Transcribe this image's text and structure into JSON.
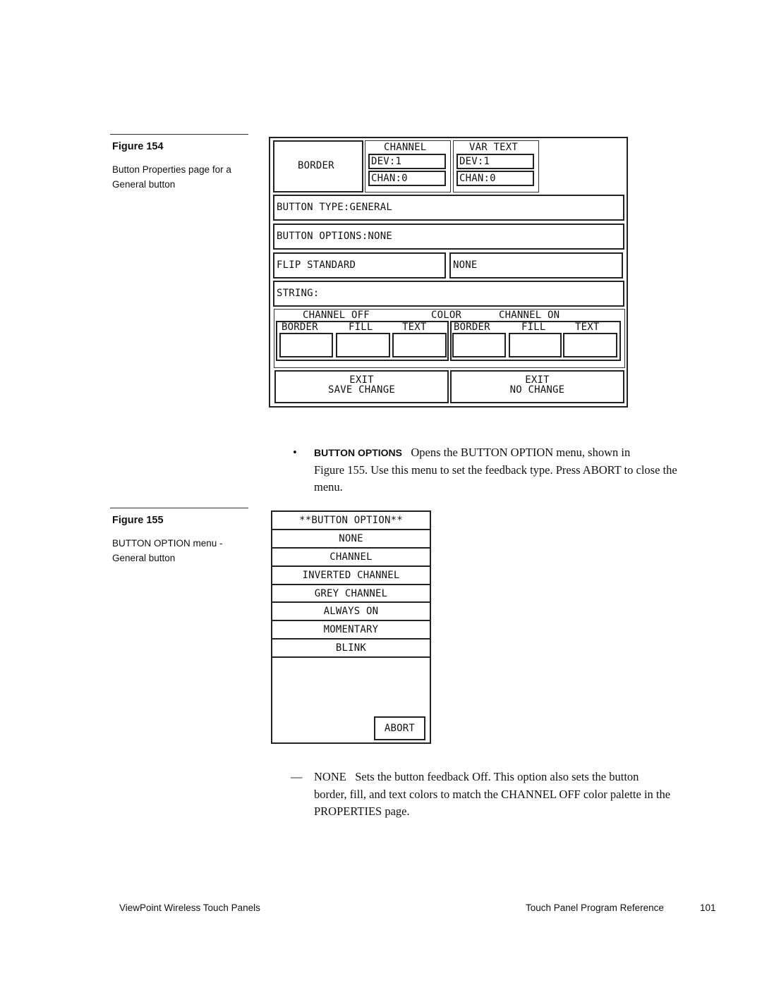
{
  "figure154": {
    "label": "Figure 154",
    "caption_line1": "Button Properties page for a",
    "caption_line2": "General button",
    "panel": {
      "border_button": "BORDER",
      "channel_group": {
        "title": "CHANNEL",
        "dev": "DEV:1",
        "chan": "CHAN:0"
      },
      "vartext_group": {
        "title": "VAR TEXT",
        "dev": "DEV:1",
        "chan": "CHAN:0"
      },
      "button_type": "BUTTON TYPE:GENERAL",
      "button_options": "BUTTON OPTIONS:NONE",
      "flip": "FLIP STANDARD",
      "flip_value": "NONE",
      "string": "STRING:",
      "color": {
        "channel_off": "CHANNEL OFF",
        "color": "COLOR",
        "channel_on": "CHANNEL ON",
        "off_labels": [
          "BORDER",
          "FILL",
          "TEXT"
        ],
        "on_labels": [
          "BORDER",
          "FILL",
          "TEXT"
        ]
      },
      "exit_save": {
        "line1": "EXIT",
        "line2": "SAVE CHANGE"
      },
      "exit_nochange": {
        "line1": "EXIT",
        "line2": "NO CHANGE"
      }
    }
  },
  "bullet": {
    "symbol": "•",
    "keyword": "BUTTON OPTIONS",
    "line1": "Opens the BUTTON OPTION menu, shown in",
    "line2": "Figure 155. Use this menu to set the feedback type. Press ABORT to close the",
    "line3": "menu."
  },
  "figure155": {
    "label": "Figure 155",
    "caption_line1": "BUTTON OPTION menu -",
    "caption_line2": "General button",
    "menu": {
      "title": "**BUTTON OPTION**",
      "items": [
        "NONE",
        "CHANNEL",
        "INVERTED CHANNEL",
        "GREY CHANNEL",
        "ALWAYS ON",
        "MOMENTARY",
        "BLINK"
      ],
      "abort": "ABORT"
    }
  },
  "dash_item": {
    "symbol": "—",
    "keyword": "NONE",
    "line1": "Sets the button feedback Off. This option also sets the button",
    "line2": "border, fill, and text colors to match the CHANNEL OFF color palette in the",
    "line3": "PROPERTIES page."
  },
  "footer": {
    "left": "ViewPoint Wireless Touch Panels",
    "right": "Touch Panel Program Reference",
    "page": "101"
  }
}
